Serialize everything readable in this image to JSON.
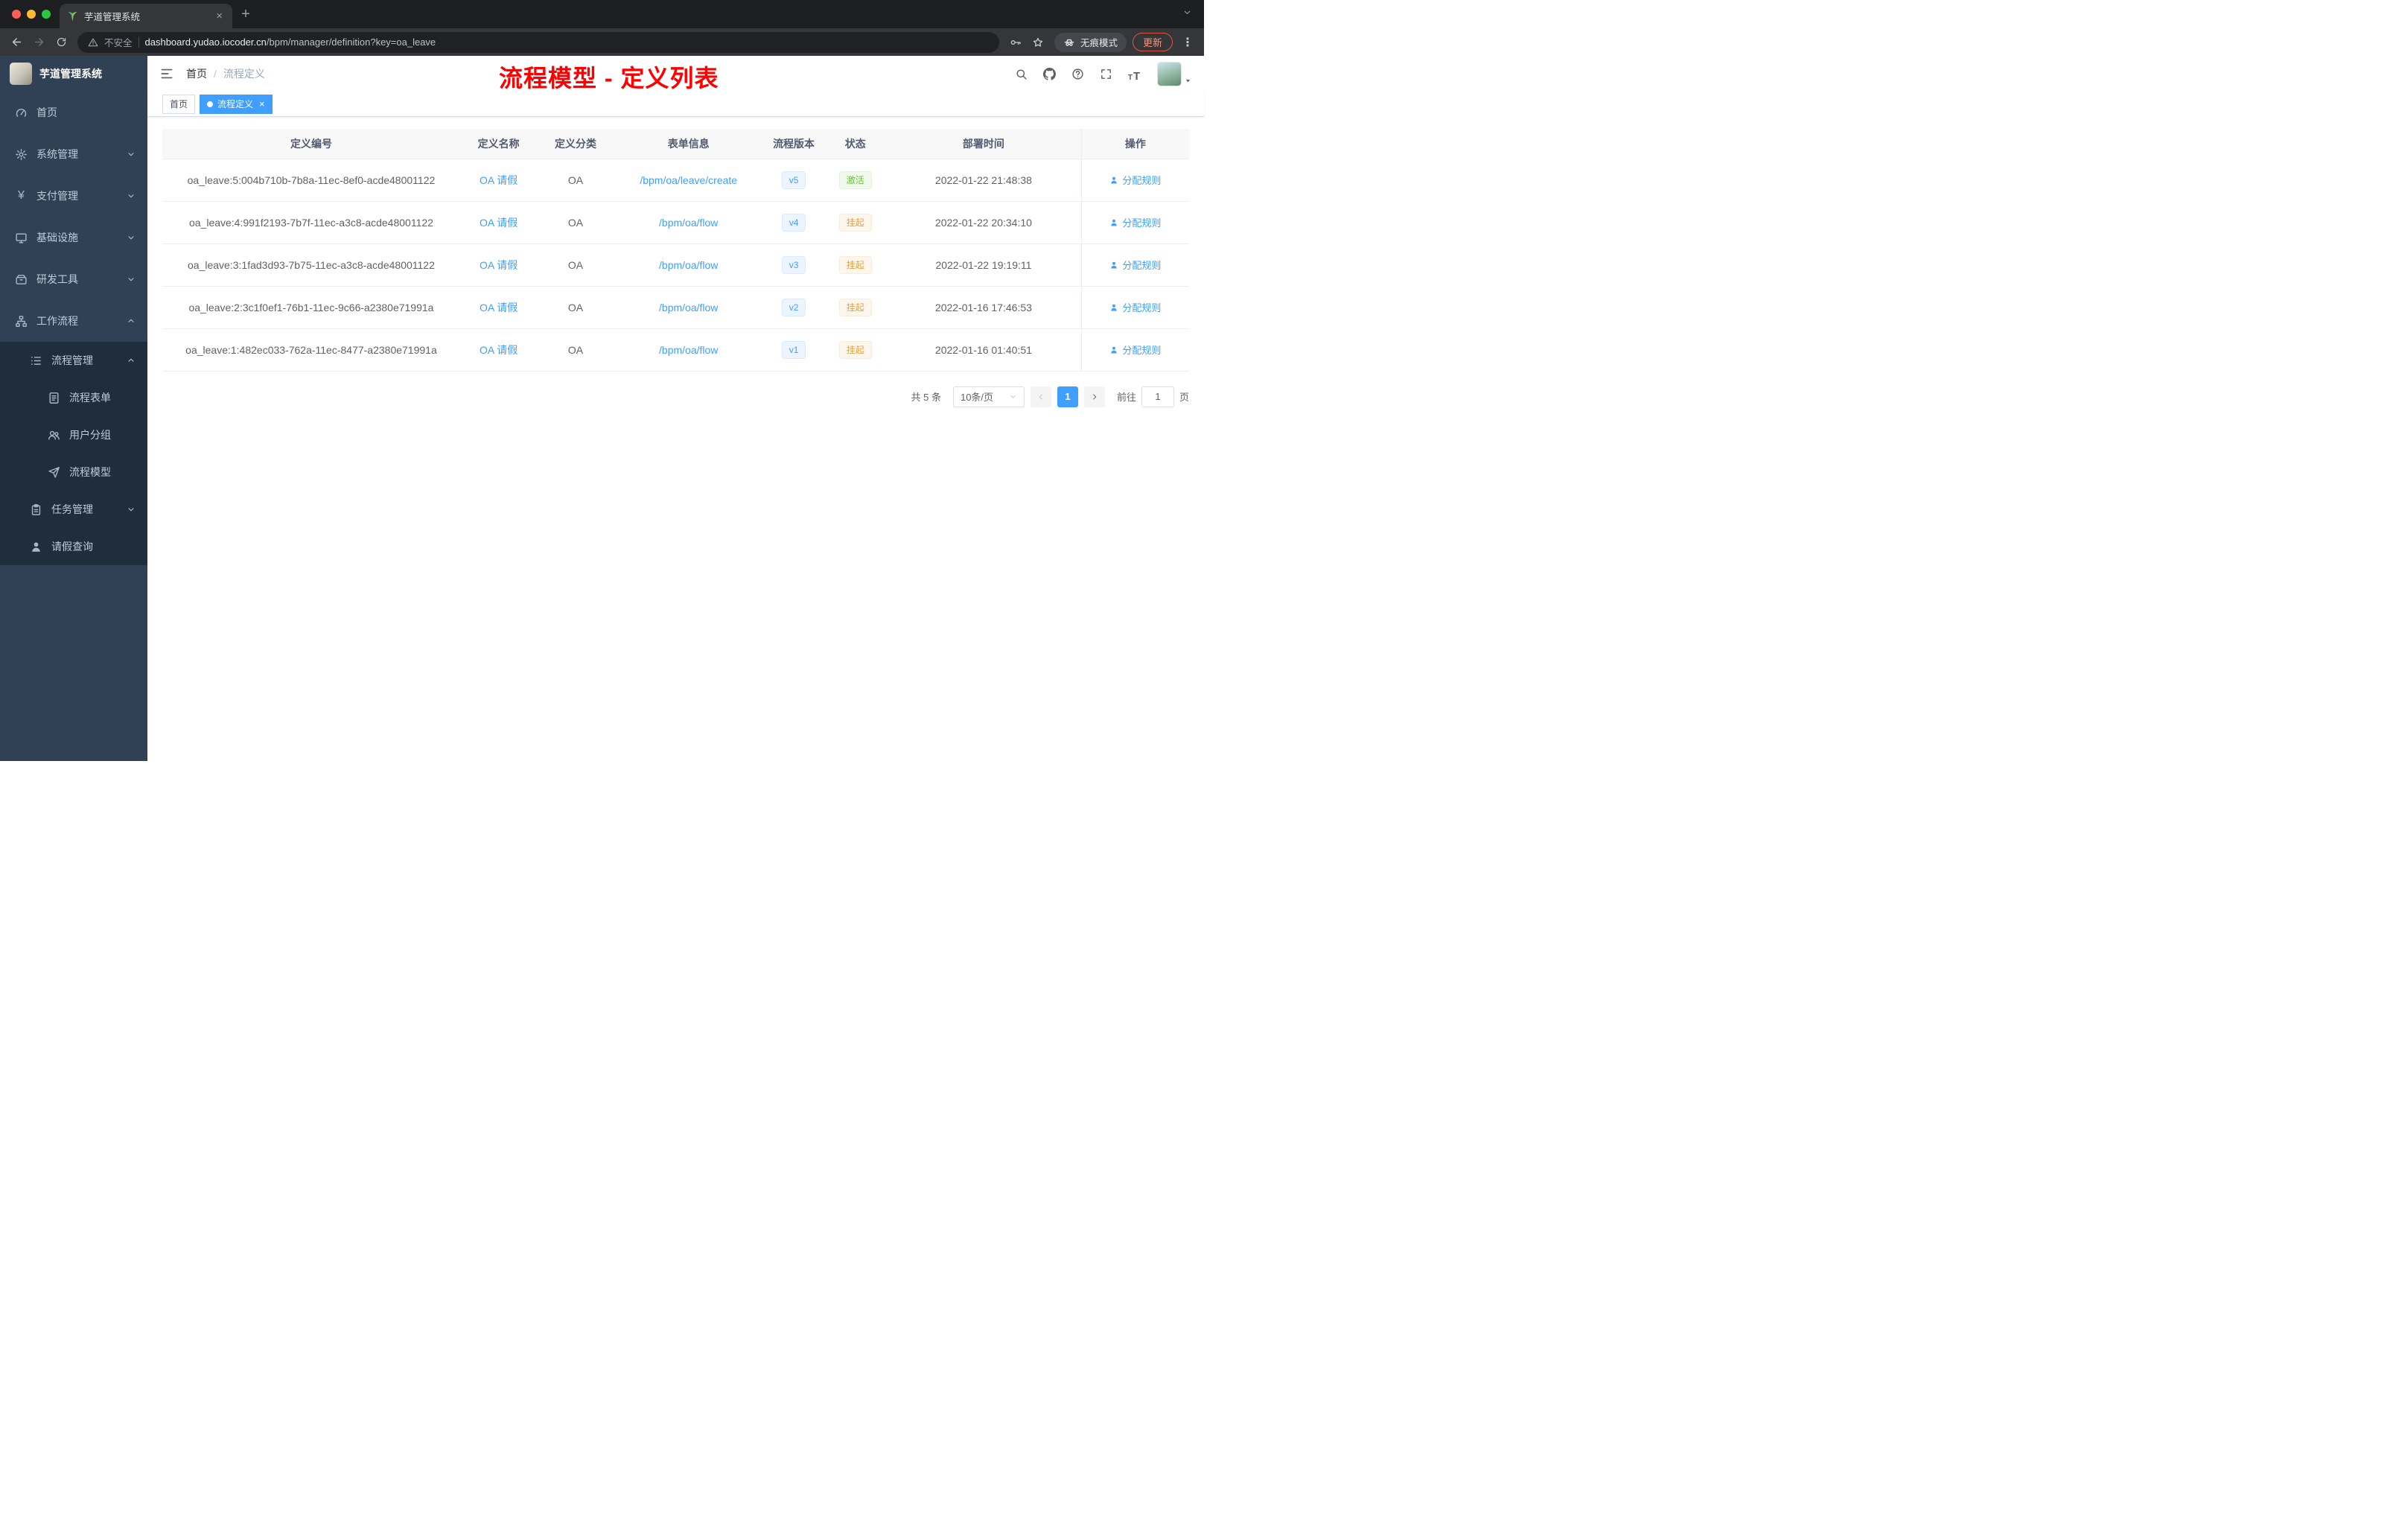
{
  "browser": {
    "tab_title": "芋道管理系统",
    "security_label": "不安全",
    "url_host": "dashboard.yudao.iocoder.cn",
    "url_path": "/bpm/manager/definition?key=oa_leave",
    "incognito_label": "无痕模式",
    "update_label": "更新"
  },
  "icons": {
    "close": "×",
    "plus": "+",
    "dots": "⋮",
    "yen": "¥",
    "font_size": "T",
    "breadcrumb_sep": "/"
  },
  "sidebar": {
    "logo_title": "芋道管理系统",
    "home": "首页",
    "system": "系统管理",
    "payment": "支付管理",
    "infra": "基础设施",
    "devtools": "研发工具",
    "workflow": "工作流程",
    "process_mgmt": "流程管理",
    "process_form": "流程表单",
    "user_group": "用户分组",
    "process_model": "流程模型",
    "task_mgmt": "任务管理",
    "leave_query": "请假查询"
  },
  "topbar": {
    "breadcrumb_home": "首页",
    "breadcrumb_current": "流程定义",
    "annotation": "流程模型 - 定义列表"
  },
  "tags": {
    "home": "首页",
    "active": "流程定义"
  },
  "table": {
    "headers": {
      "id": "定义编号",
      "name": "定义名称",
      "category": "定义分类",
      "form": "表单信息",
      "version": "流程版本",
      "status": "状态",
      "deploy_time": "部署时间",
      "actions": "操作"
    },
    "rows": [
      {
        "id": "oa_leave:5:004b710b-7b8a-11ec-8ef0-acde48001122",
        "name": "OA 请假",
        "category": "OA",
        "form": "/bpm/oa/leave/create",
        "version": "v5",
        "status": "激活",
        "deploy_time": "2022-01-22 21:48:38",
        "action": "分配规则"
      },
      {
        "id": "oa_leave:4:991f2193-7b7f-11ec-a3c8-acde48001122",
        "name": "OA 请假",
        "category": "OA",
        "form": "/bpm/oa/flow",
        "version": "v4",
        "status": "挂起",
        "deploy_time": "2022-01-22 20:34:10",
        "action": "分配规则"
      },
      {
        "id": "oa_leave:3:1fad3d93-7b75-11ec-a3c8-acde48001122",
        "name": "OA 请假",
        "category": "OA",
        "form": "/bpm/oa/flow",
        "version": "v3",
        "status": "挂起",
        "deploy_time": "2022-01-22 19:19:11",
        "action": "分配规则"
      },
      {
        "id": "oa_leave:2:3c1f0ef1-76b1-11ec-9c66-a2380e71991a",
        "name": "OA 请假",
        "category": "OA",
        "form": "/bpm/oa/flow",
        "version": "v2",
        "status": "挂起",
        "deploy_time": "2022-01-16 17:46:53",
        "action": "分配规则"
      },
      {
        "id": "oa_leave:1:482ec033-762a-11ec-8477-a2380e71991a",
        "name": "OA 请假",
        "category": "OA",
        "form": "/bpm/oa/flow",
        "version": "v1",
        "status": "挂起",
        "deploy_time": "2022-01-16 01:40:51",
        "action": "分配规则"
      }
    ]
  },
  "pagination": {
    "total": "共 5 条",
    "page_size": "10条/页",
    "current_page": "1",
    "jump_prefix": "前往",
    "jump_value": "1",
    "jump_suffix": "页"
  },
  "colors": {
    "accent": "#409eff",
    "status_active": "#67c23a",
    "status_suspended": "#e6a23c",
    "annotation_red": "#ff0000",
    "sidebar_bg": "#304156",
    "sidebar_submenu_bg": "#1f2d3d"
  }
}
